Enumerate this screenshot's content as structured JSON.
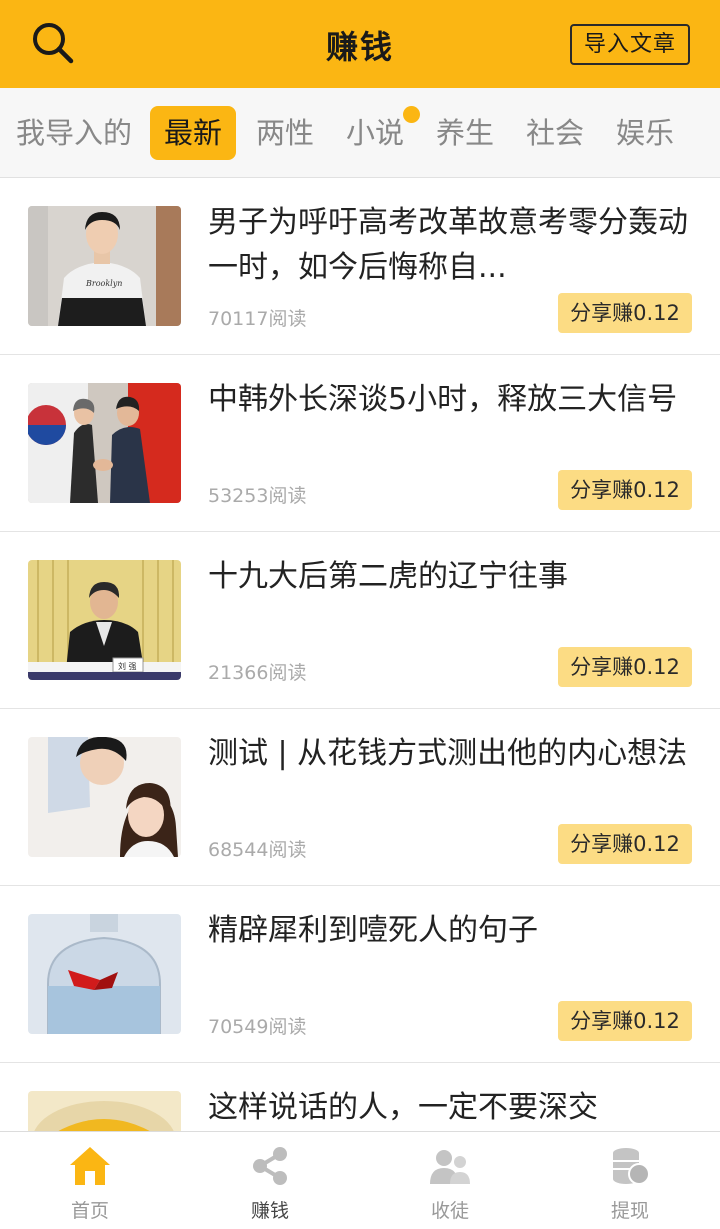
{
  "header": {
    "title": "赚钱",
    "import_label": "导入文章"
  },
  "tabs": [
    {
      "label": "我导入的",
      "active": false
    },
    {
      "label": "最新",
      "active": true
    },
    {
      "label": "两性",
      "active": false
    },
    {
      "label": "小说",
      "active": false,
      "dot": true
    },
    {
      "label": "养生",
      "active": false
    },
    {
      "label": "社会",
      "active": false
    },
    {
      "label": "娱乐",
      "active": false
    }
  ],
  "articles": [
    {
      "title": "男子为呼吁高考改革故意考零分轰动一时，如今后悔称自...",
      "reads": "70117阅读",
      "share": "分享赚0.12"
    },
    {
      "title": "中韩外长深谈5小时，释放三大信号",
      "reads": "53253阅读",
      "share": "分享赚0.12"
    },
    {
      "title": "十九大后第二虎的辽宁往事",
      "reads": "21366阅读",
      "share": "分享赚0.12"
    },
    {
      "title": "测试 | 从花钱方式测出他的内心想法",
      "reads": "68544阅读",
      "share": "分享赚0.12"
    },
    {
      "title": "精辟犀利到噎死人的句子",
      "reads": "70549阅读",
      "share": "分享赚0.12"
    },
    {
      "title": "这样说话的人，一定不要深交",
      "reads": "",
      "share": ""
    }
  ],
  "thumb_text": {
    "shirt": "Brooklyn",
    "nameplate": "刘 强"
  },
  "bottom_nav": [
    {
      "label": "首页",
      "icon": "home-icon",
      "active": false
    },
    {
      "label": "赚钱",
      "icon": "share-nodes-icon",
      "active": true
    },
    {
      "label": "收徒",
      "icon": "apprentice-icon",
      "active": false
    },
    {
      "label": "提现",
      "icon": "coins-icon",
      "active": false
    }
  ],
  "colors": {
    "accent": "#fbb613",
    "share_bg": "#fcdc84"
  }
}
